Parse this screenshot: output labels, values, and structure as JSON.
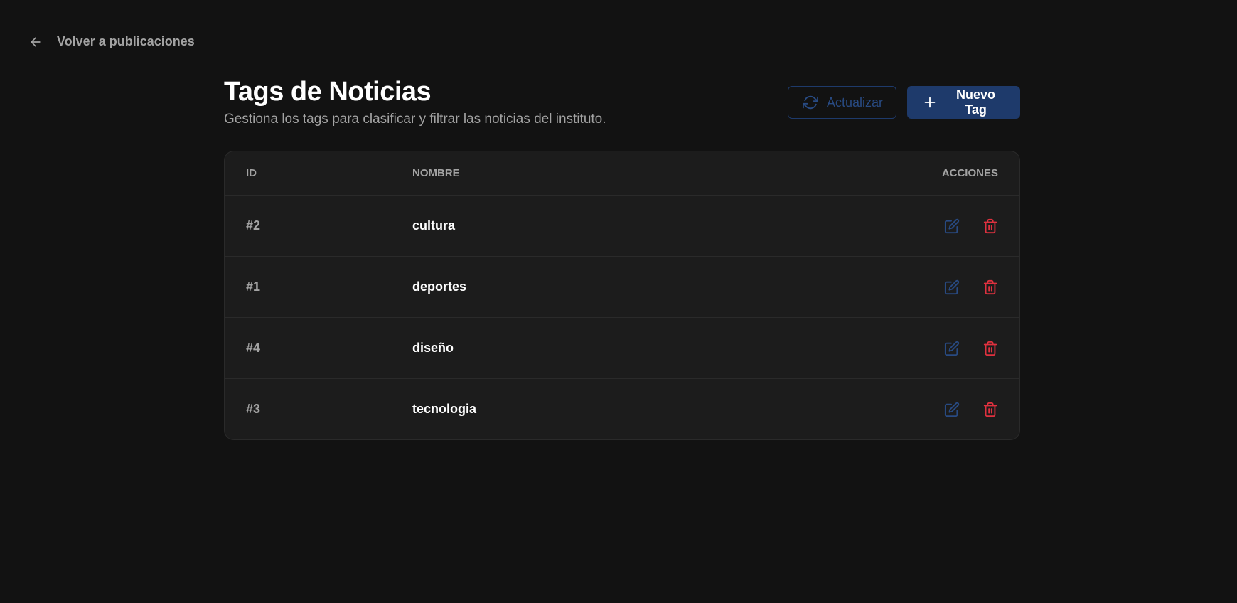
{
  "nav": {
    "back_label": "Volver a publicaciones"
  },
  "header": {
    "title": "Tags de Noticias",
    "subtitle": "Gestiona los tags para clasificar y filtrar las noticias del instituto."
  },
  "toolbar": {
    "refresh_label": "Actualizar",
    "new_label": "Nuevo Tag"
  },
  "table": {
    "columns": {
      "id": "ID",
      "name": "NOMBRE",
      "actions": "ACCIONES"
    },
    "rows": [
      {
        "id": "#2",
        "name": "cultura"
      },
      {
        "id": "#1",
        "name": "deportes"
      },
      {
        "id": "#4",
        "name": "diseño"
      },
      {
        "id": "#3",
        "name": "tecnologia"
      }
    ]
  },
  "colors": {
    "background": "#121212",
    "surface": "#1c1c1c",
    "primary": "#1e3a6b",
    "edit_icon": "#284a82",
    "delete_icon": "#e0313f",
    "muted_text": "#a3a3a3"
  },
  "icons": {
    "back": "arrow-left-icon",
    "refresh": "refresh-icon",
    "new": "plus-icon",
    "edit": "edit-icon",
    "delete": "trash-icon"
  }
}
